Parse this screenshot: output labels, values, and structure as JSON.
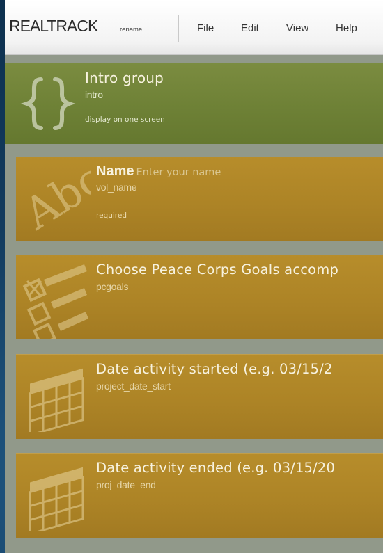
{
  "header": {
    "brand": "REALTRACK",
    "rename_label": "rename",
    "menu": [
      {
        "label": "File"
      },
      {
        "label": "Edit"
      },
      {
        "label": "View"
      },
      {
        "label": "Help"
      }
    ]
  },
  "group": {
    "title": "Intro group",
    "var_name": "intro",
    "option": "display on one screen",
    "icon": "curly-braces-icon"
  },
  "questions": [
    {
      "label": "Name",
      "hint": "Enter your name",
      "var_name": "vol_name",
      "flag": "required",
      "icon": "text-abc-icon"
    },
    {
      "label": "Choose Peace Corps Goals accomp",
      "var_name": "pcgoals",
      "icon": "checklist-icon"
    },
    {
      "label": "Date activity started (e.g. 03/15/2",
      "var_name": "project_date_start",
      "icon": "calendar-grid-icon"
    },
    {
      "label": "Date activity ended (e.g. 03/15/20",
      "var_name": "proj_date_end",
      "icon": "calendar-grid-icon"
    }
  ],
  "colors": {
    "group_header": "#6e8136",
    "question_card": "#ad8426",
    "canvas_background": "#91998a",
    "page_background": "#123b5e"
  }
}
